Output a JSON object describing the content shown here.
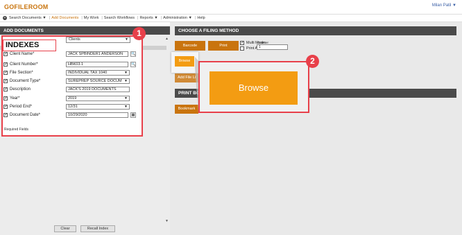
{
  "app": {
    "title": "GOFILEROOM",
    "user": "Milan Patil ▼"
  },
  "nav": {
    "items": [
      {
        "label": "Search Documents ▼"
      },
      {
        "label": "Add Documents"
      },
      {
        "label": "My Work"
      },
      {
        "label": "Search Workflows"
      },
      {
        "label": "Reports ▼"
      },
      {
        "label": "Administration ▼"
      },
      {
        "label": "Help"
      }
    ]
  },
  "left": {
    "header": "ADD DOCUMENTS",
    "drawer": "Clients",
    "indexes_label": "INDEXES",
    "fields": [
      {
        "label": "Client Name*",
        "value": "JACK SPBINDER1 ANDERSON",
        "control": "input",
        "action": "search"
      },
      {
        "label": "Client Number*",
        "value": "HBK03.1",
        "control": "input",
        "action": "search"
      },
      {
        "label": "File Section*",
        "value": "INDIVIDUAL TAX 1040",
        "control": "select"
      },
      {
        "label": "Document Type*",
        "value": "SUREPREP SOURCE DOCUM",
        "control": "select"
      },
      {
        "label": "Description",
        "value": "JACK'S 2019 DOCUMENTS",
        "control": "input"
      },
      {
        "label": "Year*",
        "value": "2019",
        "control": "select"
      },
      {
        "label": "Period End*",
        "value": "12/31",
        "control": "select"
      },
      {
        "label": "Document Date*",
        "value": "10/29/2020",
        "control": "input",
        "action": "calendar"
      }
    ],
    "required_note": "Required Fields",
    "clear_label": "Clear",
    "recall_label": "Recall Index"
  },
  "right": {
    "header": "CHOOSE A FILING METHOD",
    "barcode_label": "Barcode",
    "print_label": "Print",
    "multi_mode_label": "Multi Mode",
    "print_all_label": "Print All",
    "counter_label": "Counter",
    "counter_value": "1",
    "browse_small_label": "Browse",
    "add_file_label": "Add File Li",
    "print_bar_label": "PRINT BO",
    "bookmark_label": "Bookmark"
  },
  "callout": {
    "browse_label": "Browse",
    "badge1": "1",
    "badge2": "2"
  },
  "colors": {
    "accent": "#c9740e",
    "browse": "#f39c12",
    "highlight": "#e8404a",
    "header_bg": "#4a4a4a"
  }
}
